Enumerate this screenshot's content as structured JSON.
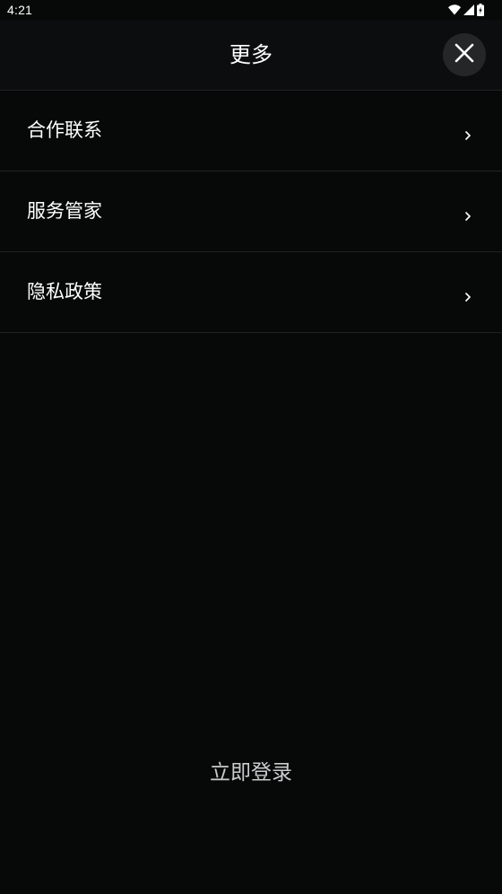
{
  "status_bar": {
    "time": "4:21",
    "icons": [
      "wifi-icon",
      "cellular-signal-icon",
      "battery-charging-icon"
    ]
  },
  "header": {
    "title": "更多",
    "close_icon": "close-icon"
  },
  "menu": {
    "items": [
      {
        "label": "合作联系",
        "icon": "chevron-right-icon"
      },
      {
        "label": "服务管家",
        "icon": "chevron-right-icon"
      },
      {
        "label": "隐私政策",
        "icon": "chevron-right-icon"
      }
    ]
  },
  "login": {
    "label": "立即登录"
  },
  "colors": {
    "background": "#070909",
    "header_background": "#0c0d0e",
    "divider": "#1f2123",
    "close_button_bg": "#242628",
    "text_primary": "#ffffff",
    "text_secondary": "#c9cbcd"
  }
}
